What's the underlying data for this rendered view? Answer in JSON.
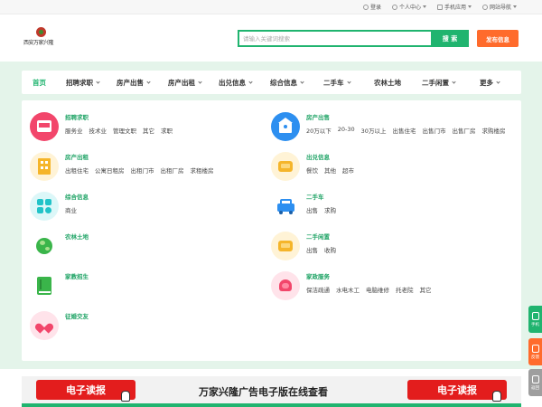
{
  "topbar": {
    "login": "登录",
    "user_center": "个人中心",
    "mobile_app": "手机应用",
    "site_nav": "网站导航"
  },
  "header": {
    "logo_text": "西安万家兴隆",
    "search_placeholder": "请输入关键词搜索",
    "search_button": "搜 索",
    "publish_button": "发布信息"
  },
  "nav": [
    {
      "label": "首页",
      "active": true,
      "dropdown": false
    },
    {
      "label": "招聘求职",
      "dropdown": true
    },
    {
      "label": "房产出售",
      "dropdown": true
    },
    {
      "label": "房产出租",
      "dropdown": true
    },
    {
      "label": "出兑信息",
      "dropdown": true
    },
    {
      "label": "综合信息",
      "dropdown": true
    },
    {
      "label": "二手车",
      "dropdown": true
    },
    {
      "label": "农林土地",
      "dropdown": false
    },
    {
      "label": "二手闲置",
      "dropdown": true
    },
    {
      "label": "更多",
      "dropdown": true
    }
  ],
  "categories": [
    {
      "key": "jobs",
      "title": "招聘求职",
      "subs": [
        "服务业",
        "技术业",
        "管理文职",
        "其它",
        "求职"
      ],
      "icon": "job-icon",
      "color": "#f2466b",
      "bg": "#ffe3ea"
    },
    {
      "key": "house_sale",
      "title": "房产出售",
      "subs": [
        "20万以下",
        "20-30",
        "30万以上",
        "出售住宅",
        "出售门市",
        "出售厂房",
        "求购楼房"
      ],
      "icon": "house-key-icon",
      "color": "#2d8ff0",
      "bg": "#dceeff"
    },
    {
      "key": "house_rent",
      "title": "房产出租",
      "subs": [
        "出租住宅",
        "公寓日租房",
        "出租门市",
        "出租厂房",
        "求租楼房"
      ],
      "icon": "building-icon",
      "color": "#f5b52a",
      "bg": "#fff3d6"
    },
    {
      "key": "transfer",
      "title": "出兑信息",
      "subs": [
        "餐饮",
        "其他",
        "超市"
      ],
      "icon": "sofa-icon",
      "color": "#f5b52a",
      "bg": "#fff3d6"
    },
    {
      "key": "general",
      "title": "综合信息",
      "subs": [
        "商业"
      ],
      "icon": "grid-icon",
      "color": "#22c3c8",
      "bg": "#dcf7f8"
    },
    {
      "key": "used_car",
      "title": "二手车",
      "subs": [
        "出售",
        "求购"
      ],
      "icon": "car-icon",
      "color": "#2d8ff0",
      "bg": "#ffffff"
    },
    {
      "key": "farmland",
      "title": "农林土地",
      "subs": [],
      "icon": "globe-icon",
      "color": "#3ab54a",
      "bg": "#ffffff"
    },
    {
      "key": "idle",
      "title": "二手闲置",
      "subs": [
        "出售",
        "收购"
      ],
      "icon": "sofa-icon",
      "color": "#f5b52a",
      "bg": "#fff3d6"
    },
    {
      "key": "education",
      "title": "家教招生",
      "subs": [],
      "icon": "book-icon",
      "color": "#3ab54a",
      "bg": "#ffffff"
    },
    {
      "key": "housekeeping",
      "title": "家政服务",
      "subs": [
        "保洁疏通",
        "水电木工",
        "电脑维修",
        "托老院",
        "其它"
      ],
      "icon": "heart-hand-icon",
      "color": "#f2466b",
      "bg": "#ffe3ea"
    },
    {
      "key": "dating",
      "title": "征婚交友",
      "subs": [],
      "icon": "heart-icon",
      "color": "#f2466b",
      "bg": "#ffe3ea"
    }
  ],
  "ads": {
    "left_button": "电子读报",
    "middle_text": "万家兴隆广告电子版在线查看",
    "right_button": "电子读报"
  },
  "side": {
    "mobile": "手机",
    "feedback": "反馈",
    "top": "返回"
  },
  "colors": {
    "brand": "#20b46f",
    "publish": "#ff6b2c",
    "band": "#e4f4ea"
  }
}
